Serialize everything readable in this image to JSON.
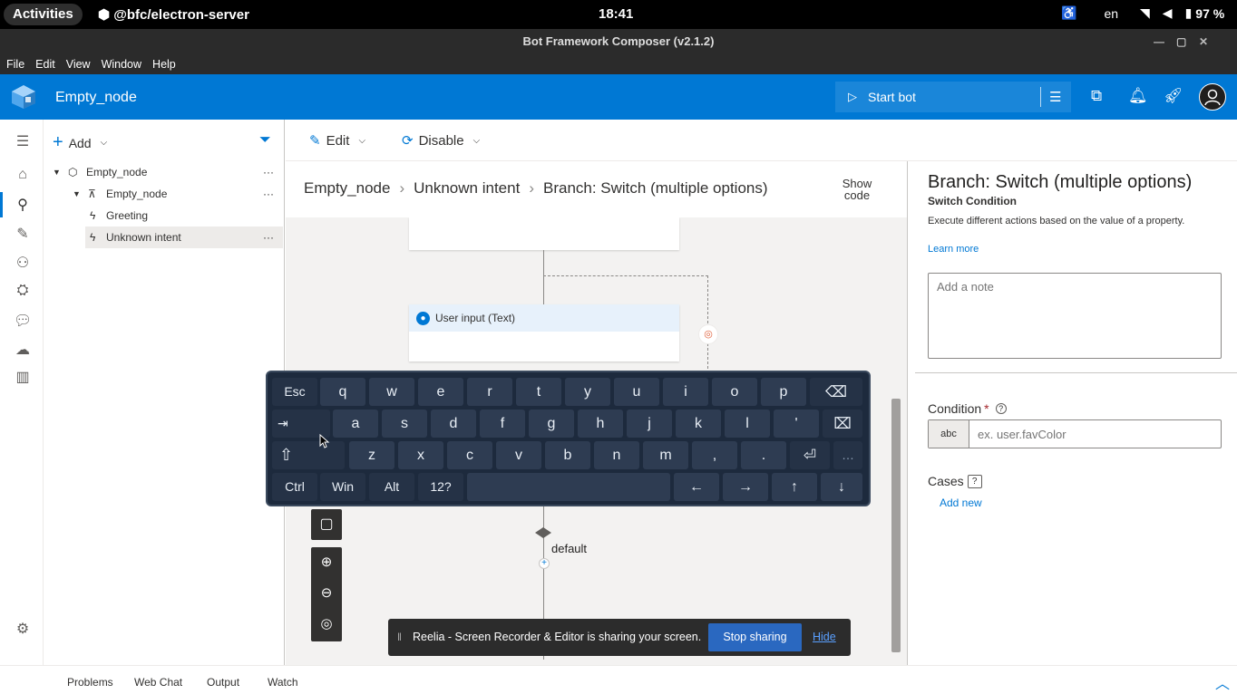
{
  "system_bar": {
    "activities": "Activities",
    "app_name": "@bfc/electron-server",
    "clock": "18:41",
    "lang": "en",
    "battery": "97 %"
  },
  "window": {
    "title": "Bot Framework Composer (v2.1.2)"
  },
  "menu": [
    "File",
    "Edit",
    "View",
    "Window",
    "Help"
  ],
  "header": {
    "project_title": "Empty_node",
    "start_bot_label": "Start bot"
  },
  "tree": {
    "add_label": "Add",
    "items": [
      {
        "label": "Empty_node",
        "more": "···"
      },
      {
        "label": "Empty_node",
        "more": "···"
      },
      {
        "label": "Greeting"
      },
      {
        "label": "Unknown intent",
        "more": "···"
      }
    ]
  },
  "commandbar": {
    "edit_label": "Edit",
    "disable_label": "Disable"
  },
  "breadcrumb": {
    "items": [
      "Empty_node",
      "Unknown intent",
      "Branch: Switch (multiple options)"
    ],
    "show_code": "Show code"
  },
  "canvas": {
    "user_input_label": "User input (Text)",
    "default_label": "default"
  },
  "properties": {
    "title": "Branch: Switch (multiple options)",
    "subtitle": "Switch Condition",
    "description": "Execute different actions based on the value of a property.",
    "learn_more": "Learn more",
    "note_placeholder": "Add a note",
    "condition_label": "Condition",
    "condition_required": "*",
    "condition_type": "abc",
    "condition_placeholder": "ex. user.favColor",
    "cases_label": "Cases",
    "add_new": "Add new"
  },
  "keyboard": {
    "row1": [
      "Esc",
      "q",
      "w",
      "e",
      "r",
      "t",
      "y",
      "u",
      "i",
      "o",
      "p",
      "⌫"
    ],
    "row2": [
      "⇥",
      "a",
      "s",
      "d",
      "f",
      "g",
      "h",
      "j",
      "k",
      "l",
      "'",
      "⌧"
    ],
    "row3": [
      "⇧",
      "z",
      "x",
      "c",
      "v",
      "b",
      "n",
      "m",
      ",",
      ".",
      "⏎",
      "…"
    ],
    "row4": [
      "Ctrl",
      "Win",
      "Alt",
      "12?",
      "",
      "←",
      "→",
      "↑",
      "↓"
    ]
  },
  "share_banner": {
    "message": "Reelia - Screen Recorder & Editor is sharing your screen.",
    "stop": "Stop sharing",
    "hide": "Hide"
  },
  "bottom_tabs": [
    "Problems",
    "Web Chat",
    "Output",
    "Watch"
  ],
  "colors": {
    "accent": "#0078d4",
    "keyboard_bg": "#1d2a3d"
  }
}
